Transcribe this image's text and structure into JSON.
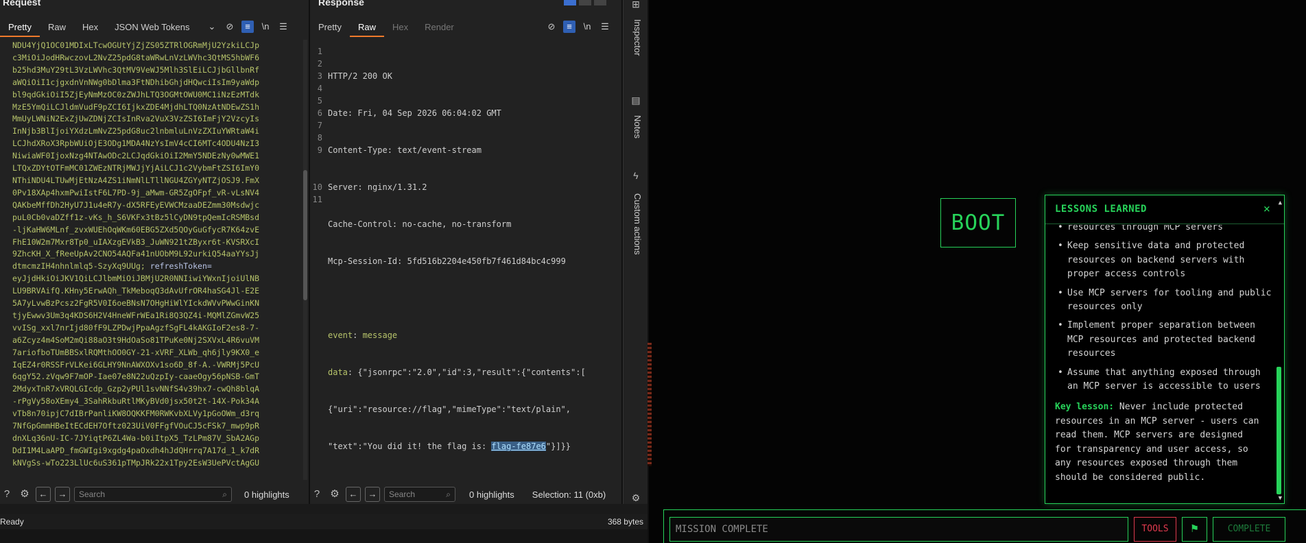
{
  "request": {
    "title": "Request",
    "tabs": [
      "Pretty",
      "Raw",
      "Hex",
      "JSON Web Tokens"
    ],
    "code_lines": [
      "NDU4YjQ1OC01MDIxLTcwOGUtYjZjZS05ZTRlOGRmMjU2YzkiLCJp",
      "c3MiOiJodHRwczovL2NvZ25pdG8taWRwLnVzLWVhc3QtMS5hbWF6",
      "b25hd3MuY29tL3VzLWVhc3QtMV9VeWJ5Mlh3SlEiLCJjbGllbnRf",
      "aWQiOiI1cjgxdnVnNWg0bDlma3FtNDhibGhjdHQwciIsIm9yaWdp",
      "bl9qdGkiOiI5ZjEyNmMzOC0zZWJhLTQ3OGMtOWU0MC1iNzEzMTdk",
      "MzE5YmQiLCJldmVudF9pZCI6IjkxZDE4MjdhLTQ0NzAtNDEwZS1h",
      "MmUyLWNiN2ExZjUwZDNjZCIsInRva2VuX3VzZSI6ImFjY2VzcyIs",
      "InNjb3BlIjoiYXdzLmNvZ25pdG8uc2lnbmluLnVzZXIuYWRtaW4i",
      "LCJhdXRoX3RpbWUiOjE3ODg1MDA4NzYsImV4cCI6MTc4ODU4NzI3",
      "NiwiaWF0IjoxNzg4NTAwODc2LCJqdGkiOiI2MmY5NDEzNy0wMWE1",
      "LTQxZDYtOTFmMC01ZWEzNTRjMWJjYjAiLCJ1c2VybmFtZSI6ImY0",
      "NThiNDU4LTUwMjEtNzA4ZS1iNmNlLTllNGU4ZGYyNTZjOSJ9.FmX",
      "0Pv18XAp4hxmPwiIstF6L7PD-9j_aMwm-GR5ZgOFpf_vR-vLsNV4",
      "QAKbeMffDh2HyU7J1u4eR7y-dX5RFEyEVWCMzaaDEZmm30Msdwjc",
      "puL0Cb0vaDZff1z-vKs_h_S6VKFx3tBz5lCyDN9tpQemIcRSMBsd",
      "-ljKaHW6MLnf_zvxWUEhOqWKm60EBG5ZXd5QOyGuGfycR7K64zvE",
      "FhE10W2m7Mxr8Tp0_uIAXzgEVkB3_JuWN921tZByxr6t-KVSRXcI",
      "9ZhcKH_X_fReeUpAv2CNO54AQFa41nUObM9L92urkiQ54aaYYsJj",
      "dtmcmzIH4nhnlmlq5-SzyXq9UUg; ",
      "eyJjdHkiOiJKV1QiLCJlbmMiOiJBMjU2R0NNIiwiYWxnIjoiUlNB",
      "LU9BRVAifQ.KHny5ErwAQh_TkMeboqQ3dAvUfrOR4haSG4Jl-E2E",
      "5A7yLvwBzPcsz2FgR5V0I6oeBNsN7OHgHiWlYIckdWVvPWwGinKN",
      "tjyEwwv3Um3q4KDS6H2V4HneWFrWEa1Ri8Q3QZ4i-MQMlZGmvW25",
      "vvISg_xxl7nrIjd80fF9LZPDwjPpaAgzfSgFL4kAKGIoF2es8-7-",
      "a6Zcyz4m4SoM2mQi88aO3t9HdOaSo81TPuKe0Nj2SXVxL4R6vuVM",
      "7ariofboTUmBBSxlRQMthOO0GY-21-xVRF_XLWb_qh6jly9KX0_e",
      "IqEZ4r0RSSFrVLKei6GLHY9NnAWXOXv1so6D_8f-A.-VWRMj5PcU",
      "6qgY52.zVqw9F7mOP-Iae07e8N22uQzpIy-caaeOgy56pNSB-GmT",
      "2MdyxTnR7xVRQLGIcdp_Gzp2yPUl1svNNfS4v39hx7-cwQh8blqA",
      "-rPgVy58oXEmy4_3SahRkbuRtlMKyBVd0jsx50t2t-14X-Pok34A",
      "vTb8n70ipjC7dIBrPanliKW8OQKKFM0RWKvbXLVy1pGoOWm_d3rq",
      "7NfGpGmmHBeItECdEH7Oftz023UiV0FFgfVOuCJ5cFSk7_mwp9pR",
      "dnXLq36nU-IC-7JYiqtP6ZL4Wa-b0iItpX5_TzLPm87V_SbA2AGp",
      "DdI1M4LaAPD_fmGWIgi9xgdg4paOxdh4hJdQHrrq7A17d_1_k7dR",
      "kNVgSs-wTo223LlUc6uS361pTMpJRk22x1Tpy2EsW3UePVctAgGU"
    ],
    "token_label": "refreshToken=",
    "search_placeholder": "Search",
    "highlights": "0 highlights"
  },
  "response": {
    "title": "Response",
    "tabs": [
      "Pretty",
      "Raw",
      "Hex",
      "Render"
    ],
    "line_numbers": [
      "1",
      "2",
      "3",
      "4",
      "5",
      "6",
      "7",
      "8",
      "9",
      "",
      "",
      "10",
      "11"
    ],
    "headers": [
      {
        "k": "HTTP/2 200 OK",
        "v": ""
      },
      {
        "k": "Date:",
        "v": " Fri, 04 Sep 2026 06:04:02 GMT"
      },
      {
        "k": "Content-Type:",
        "v": " text/event-stream"
      },
      {
        "k": "Server:",
        "v": " nginx/1.31.2"
      },
      {
        "k": "Cache-Control:",
        "v": " no-cache, no-transform"
      },
      {
        "k": "Mcp-Session-Id:",
        "v": " 5fd516b2204e450fb7f461d84bc4c999"
      }
    ],
    "event_key": "event",
    "event_value": " message",
    "data_key": "data",
    "data_line1": " {\"jsonrpc\":\"2.0\",\"id\":3,\"result\":{\"contents\":[",
    "data_line2": "{\"uri\":\"resource://flag\",\"mimeType\":\"text/plain\",",
    "data_line3_pre": "\"text\":\"You did it! the flag is: ",
    "flag": "flag-fe87e6",
    "data_line3_post": "\"}]}}",
    "search_placeholder": "Search",
    "highlights": "0 highlights",
    "selection": "Selection: 11 (0xb)"
  },
  "rail": {
    "inspector": "Inspector",
    "notes": "Notes",
    "custom_actions": "Custom actions"
  },
  "status": {
    "left": "Ready",
    "right": "368 bytes"
  },
  "game": {
    "boot_label": "BOOT",
    "lessons_title": "LESSONS LEARNED",
    "close_glyph": "×",
    "partial_line": "resources through MCP servers",
    "bullets": [
      "Keep sensitive data and protected resources on backend servers with proper access controls",
      "Use MCP servers for tooling and public resources only",
      "Implement proper separation between MCP resources and protected backend resources",
      "Assume that anything exposed through an MCP server is accessible to users"
    ],
    "key_label": "Key lesson:",
    "key_text": " Never include protected resources in an MCP server - users can read them. MCP servers are designed for transparency and user access, so any resources exposed through them should be considered public.",
    "mission_placeholder": "MISSION COMPLETE",
    "tools_label": "TOOLS",
    "flag_glyph": "⚑",
    "complete_label": "COMPLETE"
  },
  "colors": {
    "accent_green": "#27d35a",
    "tools_red": "#e03a4e",
    "tab_underline": "#f07a2b"
  }
}
